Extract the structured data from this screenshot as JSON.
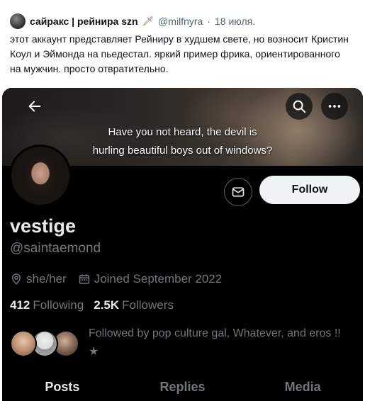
{
  "tweet": {
    "author": "сайракс | рейнира szn",
    "author_emoji": "🗡",
    "handle": "@milfnyra",
    "dot": "·",
    "date": "18 июля.",
    "body": "этот аккаунт представляет Рейниру в худшем свете, но возносит Кристин Коул и Эймонда на пьедестал. яркий пример фрика, ориентированного на мужчин. просто отвратительно."
  },
  "profile": {
    "banner_caption_line1": "Have you not heard, the devil is",
    "banner_caption_line2": "hurling beautiful boys out of windows?",
    "follow_label": "Follow",
    "display_name": "vestige",
    "handle": "@saintaemond",
    "pronouns": "she/her",
    "joined": "Joined September 2022",
    "following_count": "412",
    "following_label": "Following",
    "followers_count": "2.5K",
    "followers_label": "Followers",
    "followed_by": "Followed by pop culture gal, Whatever, and eros !! ★"
  },
  "tabs": [
    {
      "label": "Posts",
      "active": true
    },
    {
      "label": "Replies",
      "active": false
    },
    {
      "label": "Media",
      "active": false
    }
  ],
  "icons": {
    "back": "arrow-left-icon",
    "search": "search-icon",
    "more": "more-horizontal-icon",
    "message": "envelope-icon",
    "location": "location-pin-icon",
    "calendar": "calendar-icon"
  },
  "colors": {
    "card_background": "#000000",
    "primary_text": "#e7e9ea",
    "secondary_text": "#71767b",
    "follow_button": "#eff3f4"
  }
}
